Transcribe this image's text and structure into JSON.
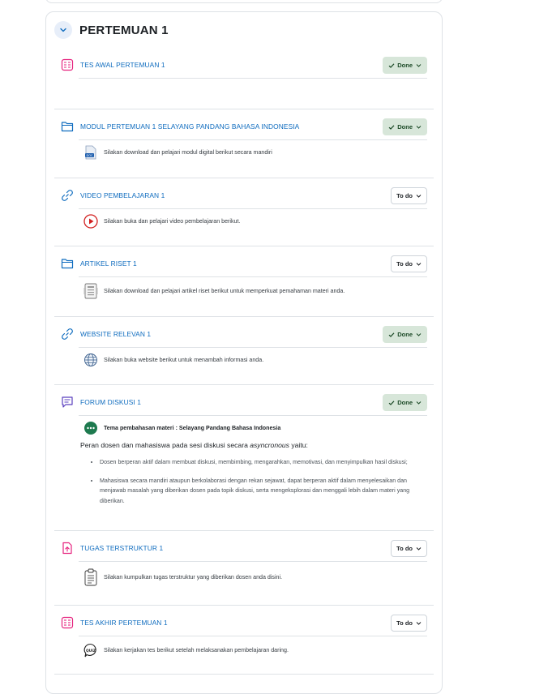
{
  "section": {
    "title": "PERTEMUAN 1",
    "collapse_icon": "chevron-down-icon"
  },
  "activities": [
    {
      "title": "TES AWAL PERTEMUAN 1",
      "icon": "quiz-icon",
      "status": "Done",
      "description": ""
    },
    {
      "title": "MODUL PERTEMUAN 1 SELAYANG PANDANG BAHASA INDONESIA",
      "icon": "folder-icon",
      "status": "Done",
      "description_icon": "doc-file-icon",
      "description": "Silakan download dan pelajari modul digital berikut secara mandiri"
    },
    {
      "title": "VIDEO PEMBELAJARAN 1",
      "icon": "link-icon",
      "status": "To do",
      "description_icon": "play-video-icon",
      "description": "Silakan buka dan pelajari video pembelajaran berikut."
    },
    {
      "title": "ARTIKEL RISET 1",
      "icon": "folder-icon",
      "status": "To do",
      "description_icon": "article-icon",
      "description": "Silakan download dan pelajari artikel riset berikut untuk memperkuat pemahaman materi anda."
    },
    {
      "title": "WEBSITE RELEVAN 1",
      "icon": "link-icon",
      "status": "Done",
      "description_icon": "globe-icon",
      "description": "Silakan buka website berikut untuk menambah informasi anda."
    },
    {
      "title": "FORUM DISKUSI 1",
      "icon": "forum-icon",
      "status": "Done",
      "description_icon": "chat-bubble-icon",
      "description": "Tema pembahasan materi : Selayang Pandang Bahasa Indonesia"
    },
    {
      "title": "TUGAS TERSTRUKTUR 1",
      "icon": "assignment-icon",
      "status": "To do",
      "description_icon": "clipboard-icon",
      "description": "Silakan kumpulkan tugas terstruktur yang diberikan dosen anda disini."
    },
    {
      "title": "TES AKHIR PERTEMUAN 1",
      "icon": "quiz-icon",
      "status": "To do",
      "description_icon": "quiz-badge-icon",
      "description": "Silakan kerjakan tes berikut setelah melaksanakan pembelajaran daring."
    }
  ],
  "forum": {
    "lead_prefix": "Peran dosen dan mahasiswa pada sesi diskusi secara ",
    "lead_italic": "asyncronous",
    "lead_suffix": " yaitu:",
    "bullets": [
      "Dosen berperan aktif dalam membuat diskusi, membimbing, mengarahkan, memotivasi, dan menyimpulkan hasil diskusi;",
      "Mahasiswa secara mandiri ataupun berkolaborasi dengan rekan sejawat, dapat berperan aktif dalam menyelesaikan dan menjawab masalah yang diberikan dosen pada topik diskusi, serta mengeksplorasi dan menggali lebih dalam materi yang diberikan."
    ]
  },
  "colors": {
    "link": "#0f6cbf",
    "done_bg": "#d7e6d9",
    "quiz_icon": "#e6237e",
    "folder_icon": "#0f6cbf",
    "link_icon": "#0f6cbf",
    "forum_icon": "#5b40bf",
    "assignment_icon": "#e6237e"
  }
}
